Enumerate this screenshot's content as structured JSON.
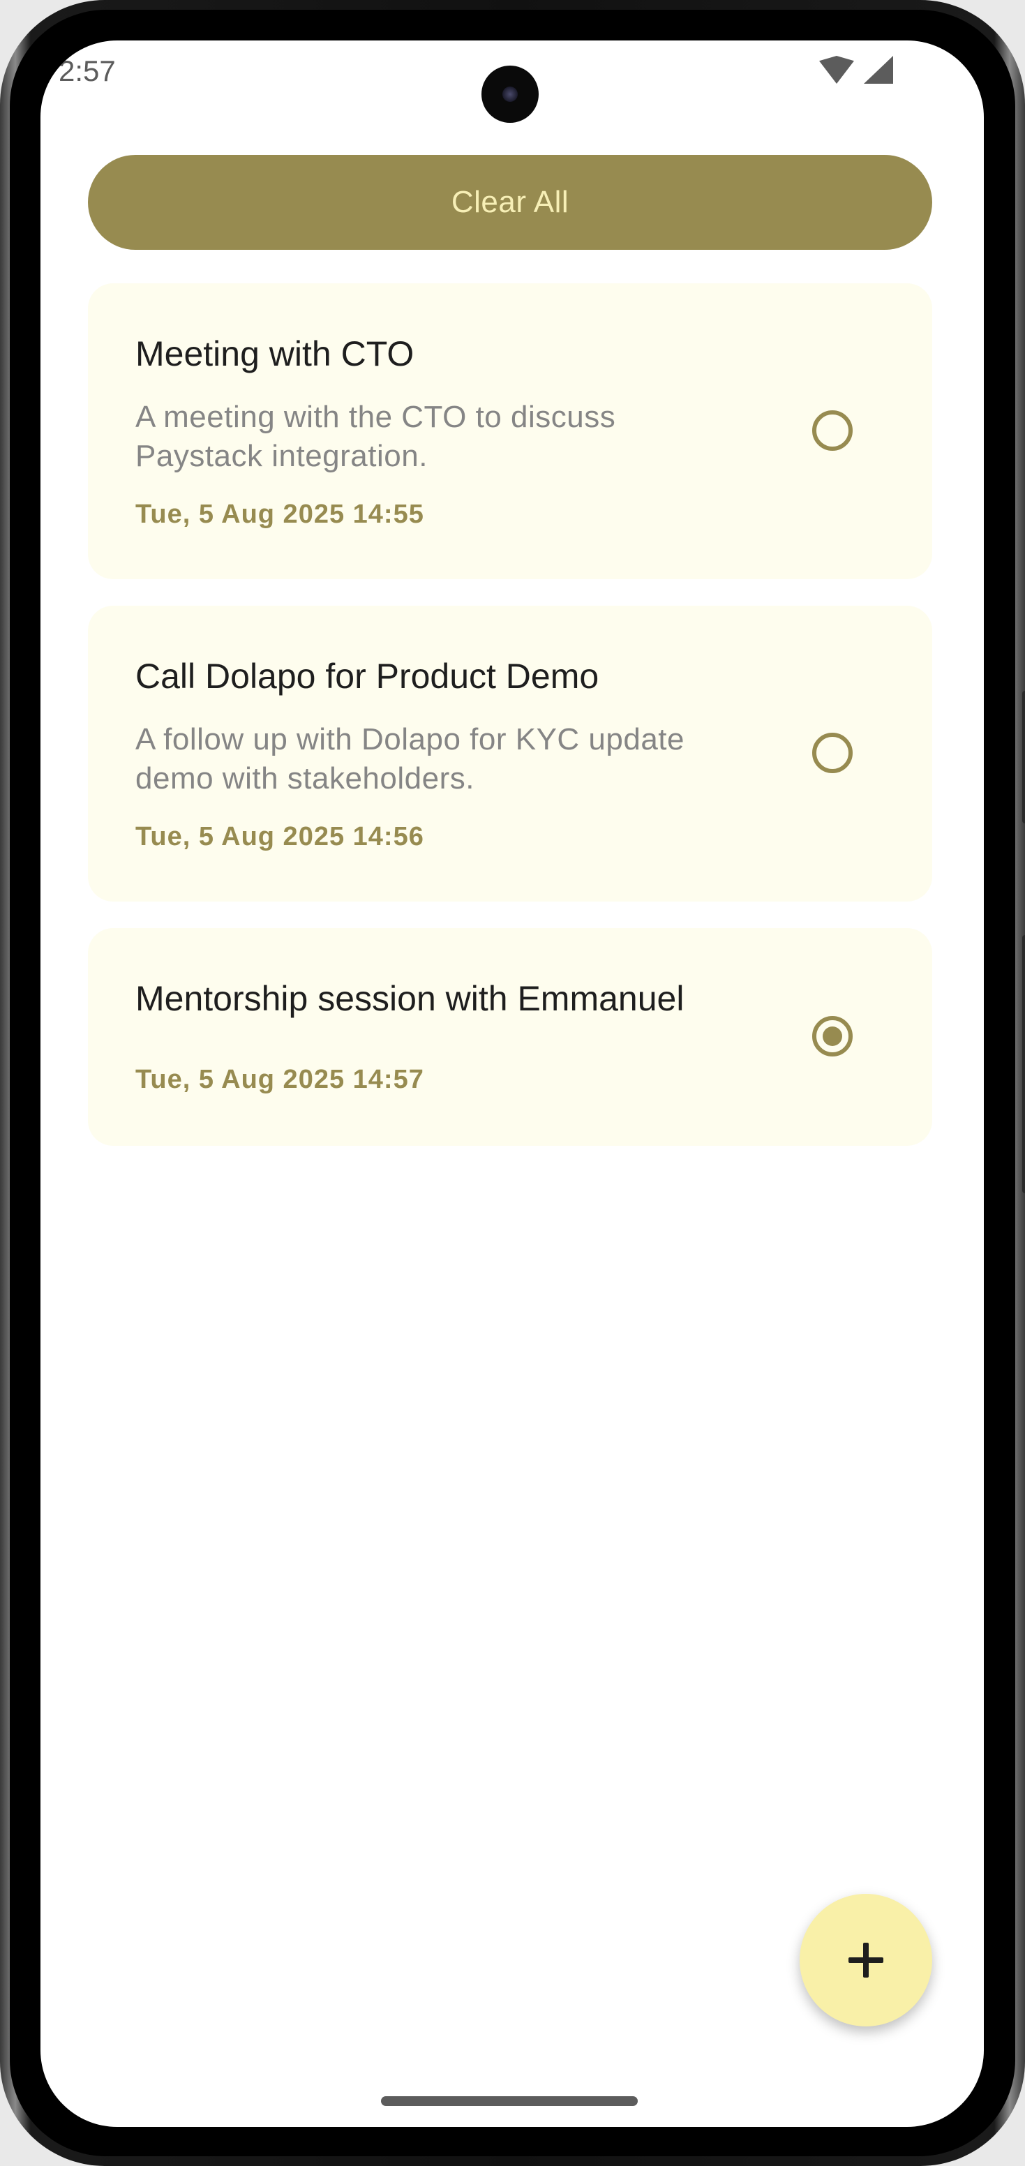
{
  "status_bar": {
    "time": "2:57",
    "icons": [
      "wifi-icon",
      "signal-icon"
    ]
  },
  "toolbar": {
    "clear_all_label": "Clear All"
  },
  "tasks": [
    {
      "title": "Meeting with CTO",
      "description_line1": "A meeting with the CTO to discuss",
      "description_line2": "Paystack integration.",
      "date": "Tue, 5 Aug 2025 14:55",
      "completed": false
    },
    {
      "title": "Call Dolapo for Product Demo",
      "description_line1": "A follow up with Dolapo for KYC update",
      "description_line2": "demo with stakeholders.",
      "date": "Tue, 5 Aug 2025 14:56",
      "completed": false
    },
    {
      "title": "Mentorship session with Emmanuel",
      "date": "Tue, 5 Aug 2025 14:57",
      "completed": true
    }
  ],
  "fab": {
    "icon": "plus-icon"
  },
  "colors": {
    "accent": "#978b50",
    "accent_text": "#f7efb6",
    "card_background": "#fefdee",
    "fab_background": "#f9f0a8"
  }
}
